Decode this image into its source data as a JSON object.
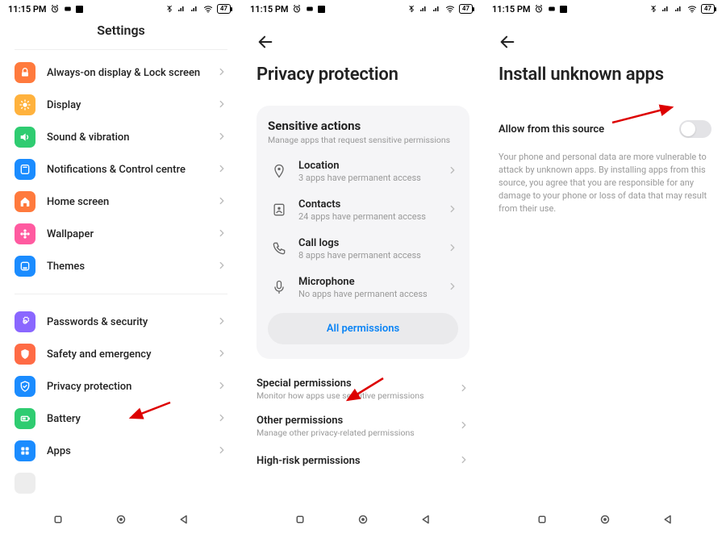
{
  "status": {
    "time": "11:15 PM",
    "battery": "47"
  },
  "panel1": {
    "title": "Settings",
    "items": [
      {
        "label": "Always-on display & Lock screen",
        "icon": "lock",
        "color": "#ff7a3d"
      },
      {
        "label": "Display",
        "icon": "sun",
        "color": "#ffb23d"
      },
      {
        "label": "Sound & vibration",
        "icon": "speaker",
        "color": "#2fcc71"
      },
      {
        "label": "Notifications & Control centre",
        "icon": "bell-panel",
        "color": "#1b8cff"
      },
      {
        "label": "Home screen",
        "icon": "home",
        "color": "#ff7a3d"
      },
      {
        "label": "Wallpaper",
        "icon": "flower",
        "color": "#ff5aa0"
      },
      {
        "label": "Themes",
        "icon": "theme",
        "color": "#1b8cff"
      }
    ],
    "items2": [
      {
        "label": "Passwords & security",
        "icon": "gear-shield",
        "color": "#8a67ff"
      },
      {
        "label": "Safety and emergency",
        "icon": "shield",
        "color": "#ff6b45"
      },
      {
        "label": "Privacy protection",
        "icon": "privacy",
        "color": "#1b8cff"
      },
      {
        "label": "Battery",
        "icon": "battery",
        "color": "#2fcc71"
      },
      {
        "label": "Apps",
        "icon": "apps",
        "color": "#1b8cff"
      }
    ]
  },
  "panel2": {
    "title": "Privacy protection",
    "card_title": "Sensitive actions",
    "card_sub": "Manage apps that request sensitive permissions",
    "perms": [
      {
        "label": "Location",
        "sub": "3 apps have permanent access",
        "icon": "pin"
      },
      {
        "label": "Contacts",
        "sub": "24 apps have permanent access",
        "icon": "contact"
      },
      {
        "label": "Call logs",
        "sub": "8 apps have permanent access",
        "icon": "phone"
      },
      {
        "label": "Microphone",
        "sub": "No apps have permanent access",
        "icon": "mic"
      }
    ],
    "all_btn": "All permissions",
    "rows": [
      {
        "label": "Special permissions",
        "sub": "Monitor how apps use sensitive permissions"
      },
      {
        "label": "Other permissions",
        "sub": "Manage other privacy-related permissions"
      },
      {
        "label": "High-risk permissions",
        "sub": ""
      }
    ]
  },
  "panel3": {
    "title": "Install unknown apps",
    "toggle_label": "Allow from this source",
    "description": "Your phone and personal data are more vulnerable to attack by unknown apps. By installing apps from this source, you agree that you are responsible for any damage to your phone or loss of data that may result from their use."
  }
}
